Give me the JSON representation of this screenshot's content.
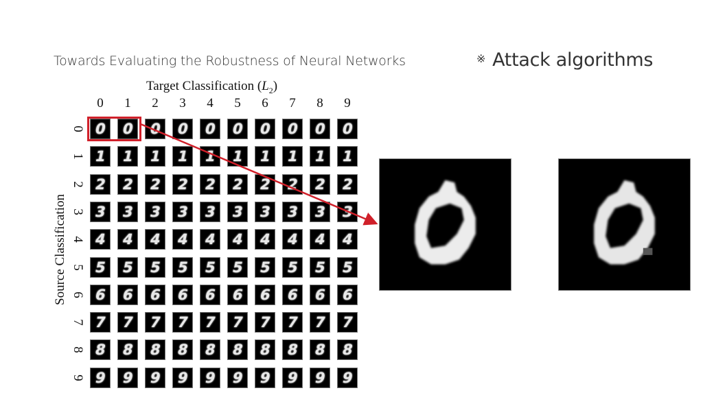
{
  "slide": {
    "title": "Towards Evaluating the Robustness of Neural Networks",
    "section_bullet": "※",
    "section_heading": "Attack algorithms"
  },
  "figure": {
    "title_main": "Target Classification (",
    "title_var": "L",
    "title_sub": "2",
    "title_close": ")",
    "x_axis_title": "Target Classification (L2)",
    "y_axis_title": "Source Classification",
    "target_labels": [
      "0",
      "1",
      "2",
      "3",
      "4",
      "5",
      "6",
      "7",
      "8",
      "9"
    ],
    "source_labels": [
      "0",
      "1",
      "2",
      "3",
      "4",
      "5",
      "6",
      "7",
      "8",
      "9"
    ],
    "cell_digits": [
      "0",
      "1",
      "2",
      "3",
      "4",
      "5",
      "6",
      "7",
      "8",
      "9"
    ],
    "highlight": {
      "source": "0",
      "targets": [
        "0",
        "1"
      ],
      "color": "#d0202a"
    },
    "zoomed_images": [
      {
        "label": "original digit 0 (source 0, target 0)"
      },
      {
        "label": "adversarial digit 0 (source 0, target 1)"
      }
    ]
  },
  "colors": {
    "accent_red": "#d0202a",
    "text": "#333333",
    "cell_bg": "#000000"
  }
}
